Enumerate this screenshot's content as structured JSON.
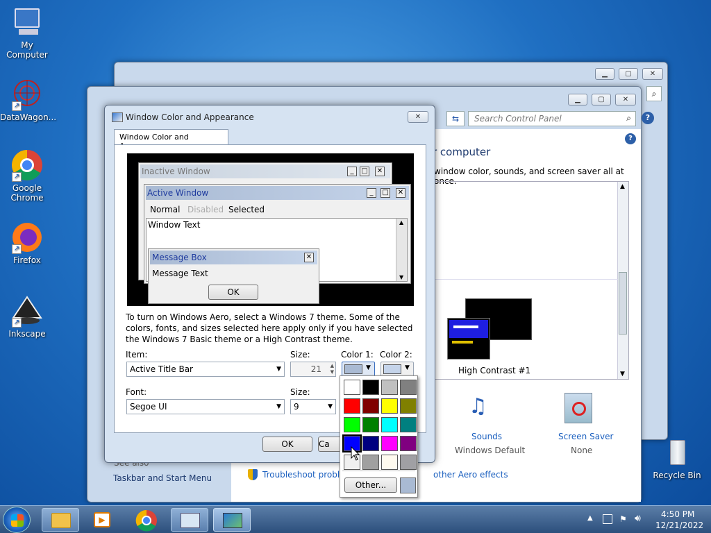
{
  "desktop": {
    "icons": [
      {
        "label": "My Computer",
        "icon": "computer-icon"
      },
      {
        "label": "DataWagon...",
        "icon": "datawagon-icon"
      },
      {
        "label": "Google\nChrome",
        "icon": "chrome-icon"
      },
      {
        "label": "Firefox",
        "icon": "firefox-icon"
      },
      {
        "label": "Inkscape",
        "icon": "inkscape-icon"
      },
      {
        "label": "Recycle Bin",
        "icon": "recycle-bin-icon"
      }
    ],
    "icon_labels": {
      "my_computer": "My Computer",
      "datawagon": "DataWagon...",
      "chrome": "Google Chrome",
      "firefox": "Firefox",
      "inkscape": "Inkscape",
      "recycle": "Recycle Bin"
    }
  },
  "control_panel": {
    "search_placeholder": "Search Control Panel",
    "heading_partial": "r computer",
    "desc_partial": "window color, sounds, and screen saver all at once.",
    "theme_name": "High Contrast #1",
    "sounds_label": "Sounds",
    "sounds_value": "Windows Default",
    "saver_label": "Screen Saver",
    "saver_value": "None",
    "see_also": "See also",
    "taskbar_link": "Taskbar and Start Menu",
    "troubleshoot_link": "Troubleshoot probler",
    "aero_link": "other Aero effects"
  },
  "dialog": {
    "title": "Window Color and Appearance",
    "tab": "Window Color and Appearance",
    "preview": {
      "inactive_title": "Inactive Window",
      "active_title": "Active Window",
      "menu_normal": "Normal",
      "menu_disabled": "Disabled",
      "menu_selected": "Selected",
      "window_text": "Window Text",
      "msgbox_title": "Message Box",
      "msgbox_text": "Message Text",
      "msgbox_ok": "OK"
    },
    "info_text": "To turn on Windows Aero, select a Windows 7 theme.  Some of the colors, fonts, and sizes selected here apply only if you have selected the Windows 7 Basic theme or a High Contrast theme.",
    "item_label": "Item:",
    "item_value": "Active Title Bar",
    "size_label": "Size:",
    "size_value": "21",
    "color1_label": "Color 1:",
    "color2_label": "Color 2:",
    "font_label": "Font:",
    "font_value": "Segoe UI",
    "font_size_label": "Size:",
    "font_size_value": "9",
    "ok": "OK",
    "cancel_partial": "Ca",
    "color1": "#a9bad3",
    "color2": "#c5d4ea"
  },
  "palette": {
    "colors": [
      "#ffffff",
      "#000000",
      "#c0c0c0",
      "#808080",
      "#ff0000",
      "#800000",
      "#ffff00",
      "#808000",
      "#00ff00",
      "#008000",
      "#00ffff",
      "#008080",
      "#0000ff",
      "#000080",
      "#ff00ff",
      "#800080",
      "#f0f0f0",
      "#a0a0a0",
      "#fffbf0",
      "#a0a0a4"
    ],
    "other_label": "Other...",
    "current": "#a9bad3"
  },
  "taskbar": {
    "time": "4:50 PM",
    "date": "12/21/2022"
  }
}
